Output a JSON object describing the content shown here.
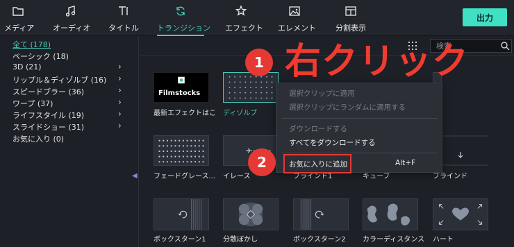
{
  "toolbar": {
    "tabs": [
      {
        "label": "メディア",
        "icon": "folder-icon"
      },
      {
        "label": "オーディオ",
        "icon": "music-note-icon"
      },
      {
        "label": "タイトル",
        "icon": "title-text-icon"
      },
      {
        "label": "トランジション",
        "icon": "transition-icon",
        "active": true
      },
      {
        "label": "エフェクト",
        "icon": "effect-star-icon"
      },
      {
        "label": "エレメント",
        "icon": "image-element-icon"
      },
      {
        "label": "分割表示",
        "icon": "split-screen-icon"
      }
    ],
    "export_label": "出力"
  },
  "sidebar": {
    "categories": [
      {
        "label": "全て (178)",
        "selected": true
      },
      {
        "label": "ベーシック (18)"
      },
      {
        "label": "3D (21)",
        "expandable": true
      },
      {
        "label": "リップル＆ディゾルブ (16)",
        "expandable": true
      },
      {
        "label": "スピードブラー (36)",
        "expandable": true
      },
      {
        "label": "ワープ (37)",
        "expandable": true
      },
      {
        "label": "ライフスタイル (19)",
        "expandable": true
      },
      {
        "label": "スライドショー (31)",
        "expandable": true
      },
      {
        "label": "お気に入り (0)"
      }
    ]
  },
  "search": {
    "placeholder": "検索",
    "value": ""
  },
  "items": [
    {
      "label": "最新エフェクトはこ",
      "thumb": "filmstocks",
      "thumb_text": "Filmstocks"
    },
    {
      "label": "ディゾルブ",
      "thumb": "dots",
      "selected": true
    },
    {
      "label": "",
      "thumb": "hidden"
    },
    {
      "label": "",
      "thumb": "hidden"
    },
    {
      "label": "",
      "thumb": "stairs"
    },
    {
      "label": "フェードグレース...",
      "thumb": "dotgrid"
    },
    {
      "label": "イレース",
      "thumb": "erase"
    },
    {
      "label": "ブラインド1",
      "thumb": "hidden"
    },
    {
      "label": "キューブ",
      "thumb": "cube"
    },
    {
      "label": "ブラインド",
      "thumb": "blinds"
    },
    {
      "label": "ボックスターン1",
      "thumb": "boxturn"
    },
    {
      "label": "分散ぼかし",
      "thumb": "scatter"
    },
    {
      "label": "ボックスターン2",
      "thumb": "boxturn"
    },
    {
      "label": "カラーディスタンス",
      "thumb": "color"
    },
    {
      "label": "ハート",
      "thumb": "heart"
    }
  ],
  "context_menu": {
    "items": [
      {
        "label": "選択クリップに適用",
        "enabled": false
      },
      {
        "label": "選択クリップにランダムに適用する",
        "enabled": false
      },
      {
        "label": "ダウンロードする",
        "enabled": false
      },
      {
        "label": "すべてをダウンロードする",
        "enabled": true
      },
      {
        "label": "お気に入りに追加",
        "enabled": true,
        "shortcut": "Alt+F"
      }
    ]
  },
  "annotations": {
    "step1": "1",
    "step1_text": "右クリック",
    "step2": "2"
  },
  "colors": {
    "accent": "#46c9b8",
    "annotation_red": "#e53935",
    "export_button": "#3fe0c4"
  }
}
